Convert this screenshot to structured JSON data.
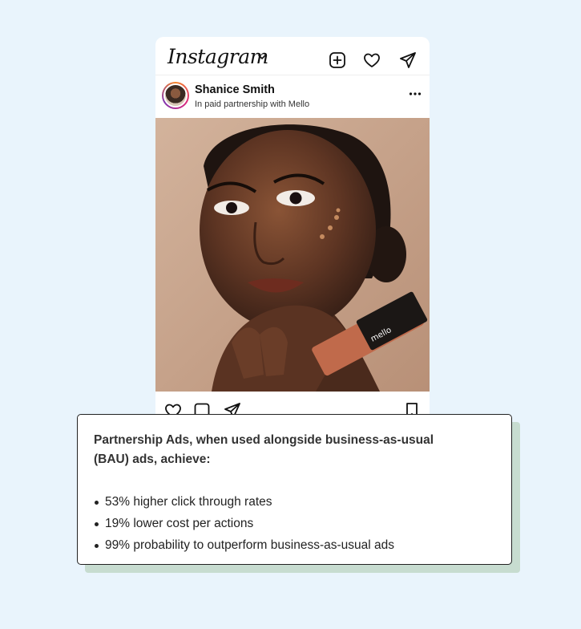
{
  "instagram": {
    "logo_text": "Instagram",
    "header_icons": [
      "add-post-icon",
      "heart-icon",
      "send-icon"
    ]
  },
  "post": {
    "user_name": "Shanice Smith",
    "subtitle": "In paid partnership with Mello",
    "photo_description_icon": "portrait-photo",
    "actions": [
      "like-icon",
      "comment-icon",
      "share-icon",
      "save-icon"
    ]
  },
  "callout": {
    "heading": "Partnership Ads, when used alongside business-as-usual (BAU) ads, achieve:",
    "bullets": [
      "53% higher click through rates",
      "19% lower cost per actions",
      "99% probability to outperform business-as-usual ads"
    ]
  },
  "colors": {
    "background": "#e9f4fc",
    "card": "#ffffff",
    "shadow": "#c7dcd0"
  }
}
